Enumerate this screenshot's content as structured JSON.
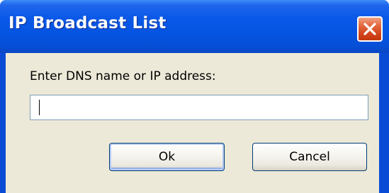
{
  "window": {
    "title": "IP Broadcast List",
    "close_icon": "close-x-icon"
  },
  "dialog": {
    "prompt": "Enter DNS name or IP address:",
    "input_value": "",
    "ok_label": "Ok",
    "cancel_label": "Cancel"
  },
  "colors": {
    "titlebar": "#0a58e8",
    "close_button": "#d3461c",
    "client_background": "#ece9d8",
    "input_border": "#7f9db9",
    "button_border": "#003c74"
  }
}
